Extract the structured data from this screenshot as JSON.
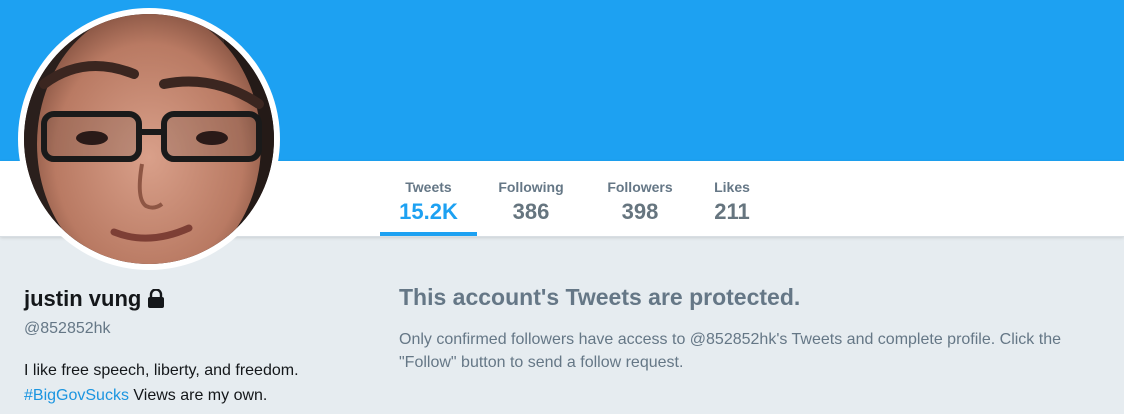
{
  "profile": {
    "name": "justin vung",
    "handle": "@852852hk",
    "bio_text": "I like free speech, liberty, and freedom.",
    "bio_hashtag": "#BigGovSucks",
    "bio_suffix": " Views are my own."
  },
  "nav": {
    "tweets": {
      "label": "Tweets",
      "value": "15.2K"
    },
    "following": {
      "label": "Following",
      "value": "386"
    },
    "followers": {
      "label": "Followers",
      "value": "398"
    },
    "likes": {
      "label": "Likes",
      "value": "211"
    }
  },
  "protected": {
    "title": "This account's Tweets are protected.",
    "message": "Only confirmed followers have access to @852852hk's Tweets and complete profile. Click the \"Follow\" button to send a follow request."
  },
  "colors": {
    "brand": "#1da1f2",
    "background": "#e6ecf0",
    "muted_text": "#657786",
    "link": "#1b95e0"
  },
  "icons": {
    "lock": "lock-icon"
  }
}
